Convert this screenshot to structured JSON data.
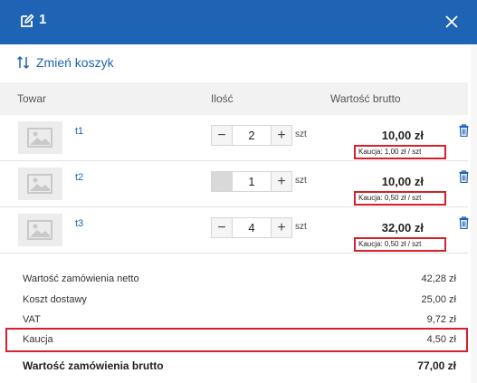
{
  "header": {
    "title": "1"
  },
  "change_cart": {
    "label": "Zmień koszyk"
  },
  "columns": {
    "product": "Towar",
    "quantity": "Ilość",
    "gross_value": "Wartość brutto"
  },
  "items": [
    {
      "name": "t1",
      "quantity": "2",
      "unit": "szt",
      "price": "10,00 zł",
      "deposit": "Kaucja: 1,00 zł / szt",
      "minus_disabled": false
    },
    {
      "name": "t2",
      "quantity": "1",
      "unit": "szt",
      "price": "10,00 zł",
      "deposit": "Kaucja: 0,50 zł / szt",
      "minus_disabled": true
    },
    {
      "name": "t3",
      "quantity": "4",
      "unit": "szt",
      "price": "32,00 zł",
      "deposit": "Kaucja: 0,50 zł / szt",
      "minus_disabled": false
    }
  ],
  "summary": {
    "net_label": "Wartość zamówienia netto",
    "net_value": "42,28 zł",
    "shipping_label": "Koszt dostawy",
    "shipping_value": "25,00 zł",
    "vat_label": "VAT",
    "vat_value": "9,72 zł",
    "deposit_label": "Kaucja",
    "deposit_value": "4,50 zł",
    "total_label": "Wartość zamówienia brutto",
    "total_value": "77,00 zł"
  },
  "colors": {
    "header_bg": "#1e63b4",
    "accent": "#1e63b4",
    "highlight": "#d6202b"
  },
  "icons": {
    "edit": "edit-icon",
    "close": "close-icon",
    "sort": "sort-arrows-icon",
    "image": "image-placeholder-icon",
    "trash": "trash-icon"
  }
}
